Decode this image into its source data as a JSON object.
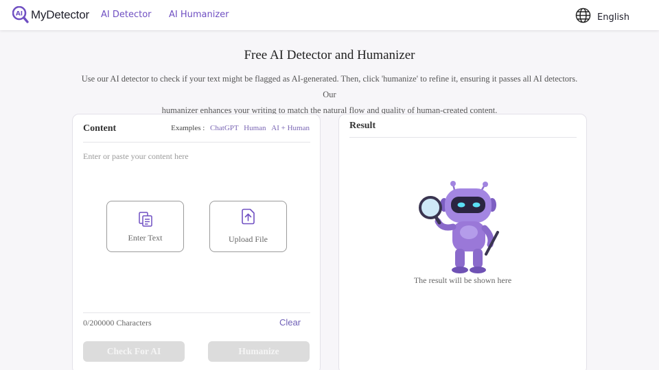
{
  "header": {
    "logo_mark": "AI",
    "brand": "MyDetector",
    "nav": [
      "AI Detector",
      "AI Humanizer"
    ],
    "language": "English"
  },
  "hero": {
    "title": "Free AI Detector and Humanizer",
    "description_line1": "Use our AI detector to check if your text might be flagged as AI-generated. Then, click 'humanize' to refine it, ensuring it passes all AI detectors. Our",
    "description_line2": "humanizer enhances your writing to match the natural flow and quality of human-created content."
  },
  "content_panel": {
    "title": "Content",
    "examples_label": "Examples :",
    "examples": [
      "ChatGPT",
      "Human",
      "AI + Human"
    ],
    "placeholder": "Enter or paste your content here",
    "enter_text_label": "Enter Text",
    "upload_file_label": "Upload File",
    "char_count": "0/200000 Characters",
    "clear_label": "Clear",
    "check_button": "Check For AI",
    "humanize_button": "Humanize"
  },
  "result_panel": {
    "title": "Result",
    "empty_message": "The result will be shown here"
  },
  "colors": {
    "accent": "#6f4fc2",
    "robot_body": "#9a78d8",
    "button_disabled": "#dcdcdc"
  },
  "icons": {
    "logo": "magnifier-ai-logo-icon",
    "language": "globe-icon",
    "enter_text": "clipboard-icon",
    "upload_file": "file-upload-icon",
    "result_illustration": "robot-with-magnifier-icon"
  }
}
